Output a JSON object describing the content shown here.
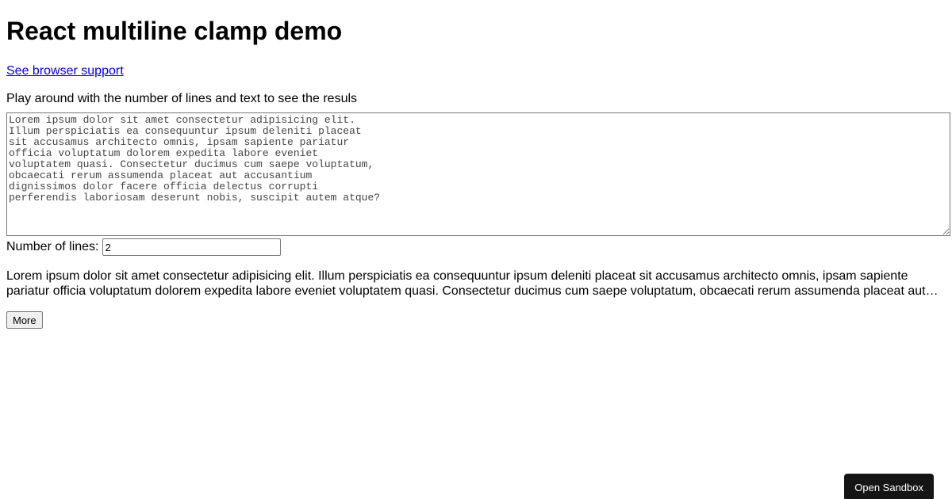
{
  "page": {
    "title": "React multiline clamp demo",
    "support_link": "See browser support",
    "instructions": "Play around with the number of lines and text to see the resuls"
  },
  "editor": {
    "value": "Lorem ipsum dolor sit amet consectetur adipisicing elit.\nIllum perspiciatis ea consequuntur ipsum deleniti placeat\nsit accusamus architecto omnis, ipsam sapiente pariatur\nofficia voluptatum dolorem expedita labore eveniet\nvoluptatem quasi. Consectetur ducimus cum saepe voluptatum,\nobcaecati rerum assumenda placeat aut accusantium\ndignissimos dolor facere officia delectus corrupti\nperferendis laboriosam deserunt nobis, suscipit autem atque?"
  },
  "lines_control": {
    "label": "Number of lines:",
    "value": "2"
  },
  "clamped": {
    "text": "Lorem ipsum dolor sit amet consectetur adipisicing elit. Illum perspiciatis ea consequuntur ipsum deleniti placeat sit accusamus architecto omnis, ipsam sapiente pariatur officia voluptatum dolorem expedita labore eveniet voluptatem quasi. Consectetur ducimus cum saepe voluptatum, obcaecati rerum assumenda placeat aut accusantium dignissimos dolor facere officia delectus corrupti perferendis laboriosam deserunt nobis, suscipit autem atque?",
    "more_label": "More"
  },
  "sandbox": {
    "label": "Open Sandbox"
  },
  "colors": {
    "link": "#0000ee",
    "sandbox_button_bg": "#151515",
    "sandbox_button_text": "#ffffff"
  }
}
